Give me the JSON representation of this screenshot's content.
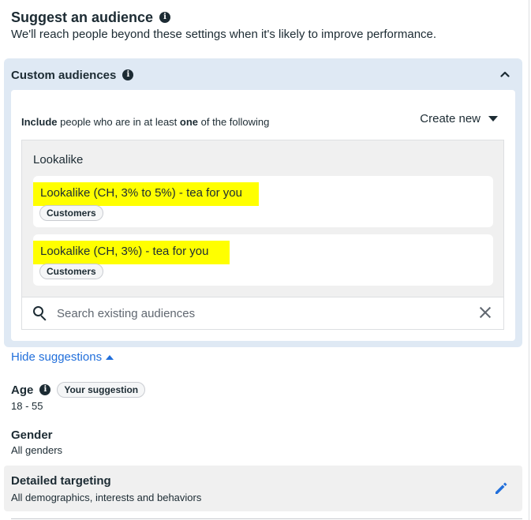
{
  "header": {
    "title": "Suggest an audience",
    "subtitle": "We'll reach people beyond these settings when it's likely to improve performance."
  },
  "custom_audiences": {
    "title": "Custom audiences",
    "include_prefix": "Include",
    "include_mid": " people who are in at least ",
    "include_one": "one",
    "include_suffix": " of the following",
    "create_new_label": "Create new",
    "group_label": "Lookalike",
    "items": [
      {
        "name": "Lookalike (CH, 3% to 5%) - tea for you",
        "tag": "Customers"
      },
      {
        "name": "Lookalike (CH, 3%) - tea for you",
        "tag": "Customers"
      }
    ],
    "search": {
      "placeholder": "Search existing audiences",
      "value": ""
    }
  },
  "hide_suggestions_label": "Hide suggestions",
  "age": {
    "label": "Age",
    "badge": "Your suggestion",
    "value": "18 - 55"
  },
  "gender": {
    "label": "Gender",
    "value": "All genders"
  },
  "detailed_targeting": {
    "label": "Detailed targeting",
    "value": "All demographics, interests and behaviors"
  },
  "icons": {
    "info": "info-icon",
    "collapse": "chevron-up-icon",
    "create_new_caret": "caret-down-icon",
    "search": "search-icon",
    "clear": "close-icon",
    "hide_caret": "caret-up-icon",
    "edit": "pencil-icon"
  },
  "colors": {
    "text": "#1c2b33",
    "link": "#216fdb",
    "panel_bg": "#dfe9f4",
    "highlight": "#ffff00",
    "muted_bg": "#f0f0f0"
  }
}
